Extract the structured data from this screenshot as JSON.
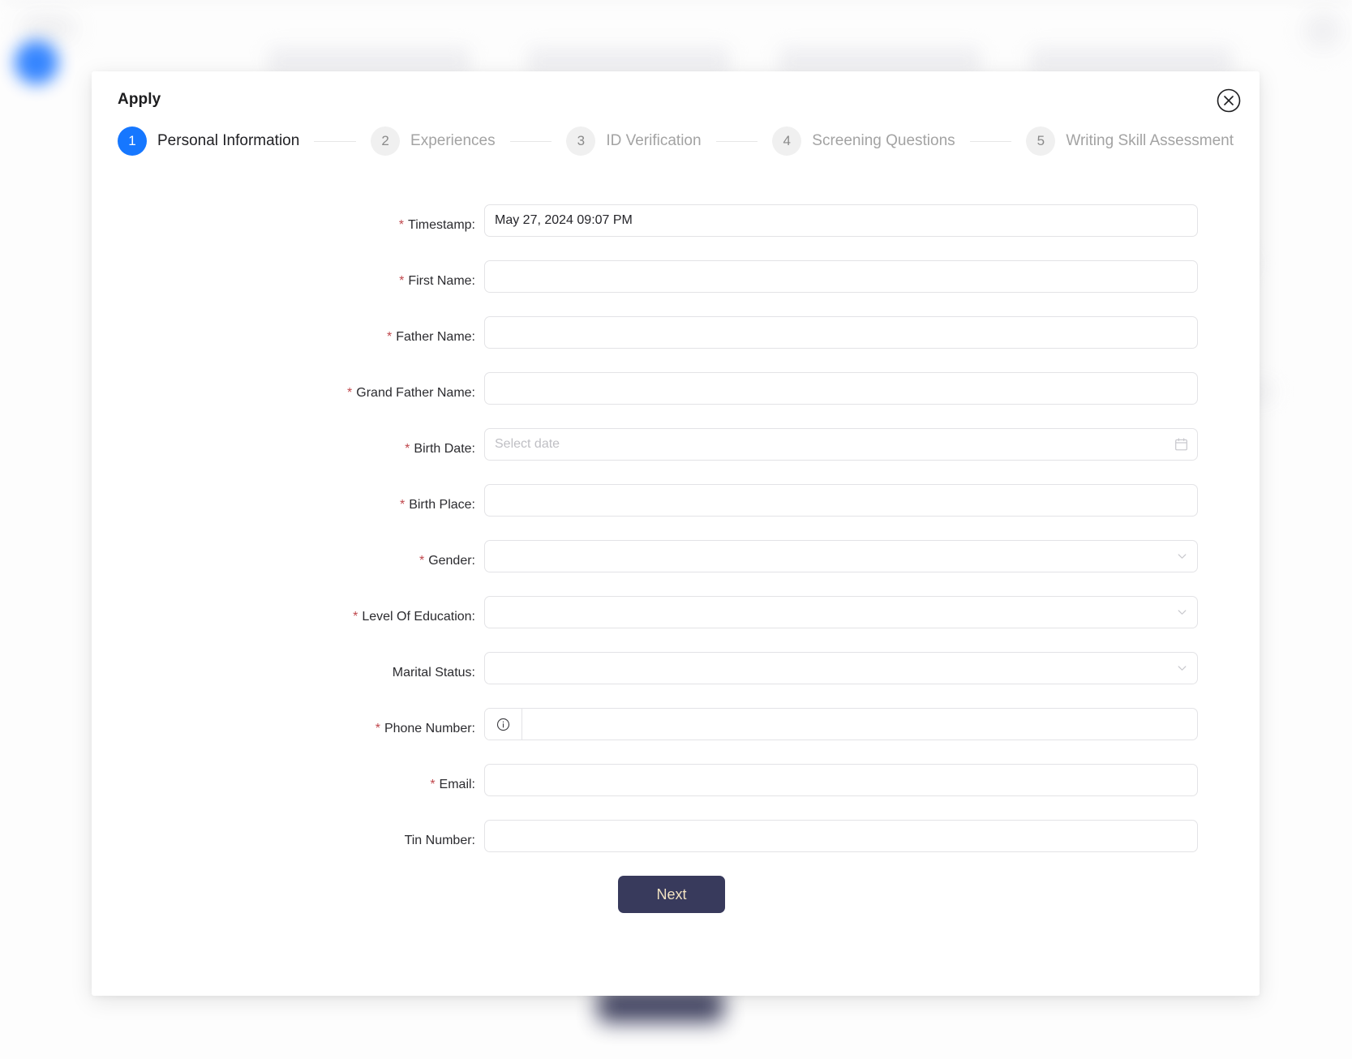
{
  "modal": {
    "title": "Apply",
    "close_icon": "close-circle-icon"
  },
  "stepper": {
    "steps": [
      {
        "num": "1",
        "label": "Personal Information",
        "state": "active"
      },
      {
        "num": "2",
        "label": "Experiences",
        "state": "inactive"
      },
      {
        "num": "3",
        "label": "ID Verification",
        "state": "inactive"
      },
      {
        "num": "4",
        "label": "Screening Questions",
        "state": "inactive"
      },
      {
        "num": "5",
        "label": "Writing Skill Assessment",
        "state": "inactive"
      }
    ]
  },
  "form": {
    "fields": [
      {
        "label": "Timestamp:",
        "required": true,
        "type": "text",
        "value": "May 27, 2024 09:07 PM",
        "placeholder": ""
      },
      {
        "label": "First Name:",
        "required": true,
        "type": "text",
        "value": "",
        "placeholder": ""
      },
      {
        "label": "Father Name:",
        "required": true,
        "type": "text",
        "value": "",
        "placeholder": ""
      },
      {
        "label": "Grand Father Name:",
        "required": true,
        "type": "text",
        "value": "",
        "placeholder": ""
      },
      {
        "label": "Birth Date:",
        "required": true,
        "type": "date",
        "value": "",
        "placeholder": "Select date"
      },
      {
        "label": "Birth Place:",
        "required": true,
        "type": "text",
        "value": "",
        "placeholder": ""
      },
      {
        "label": "Gender:",
        "required": true,
        "type": "select",
        "value": "",
        "placeholder": ""
      },
      {
        "label": "Level Of Education:",
        "required": true,
        "type": "select",
        "value": "",
        "placeholder": ""
      },
      {
        "label": "Marital Status:",
        "required": false,
        "type": "select",
        "value": "",
        "placeholder": ""
      },
      {
        "label": "Phone Number:",
        "required": true,
        "type": "phone",
        "value": "",
        "placeholder": ""
      },
      {
        "label": "Email:",
        "required": true,
        "type": "text",
        "value": "",
        "placeholder": ""
      },
      {
        "label": "Tin Number:",
        "required": false,
        "type": "text",
        "value": "",
        "placeholder": ""
      }
    ],
    "required_marker": "*",
    "next_label": "Next"
  },
  "colors": {
    "accent_blue": "#1677ff",
    "required_red": "#c0484d",
    "button_bg": "#383a5c",
    "button_text": "#f2e3c2",
    "border": "#e3e3e6"
  }
}
